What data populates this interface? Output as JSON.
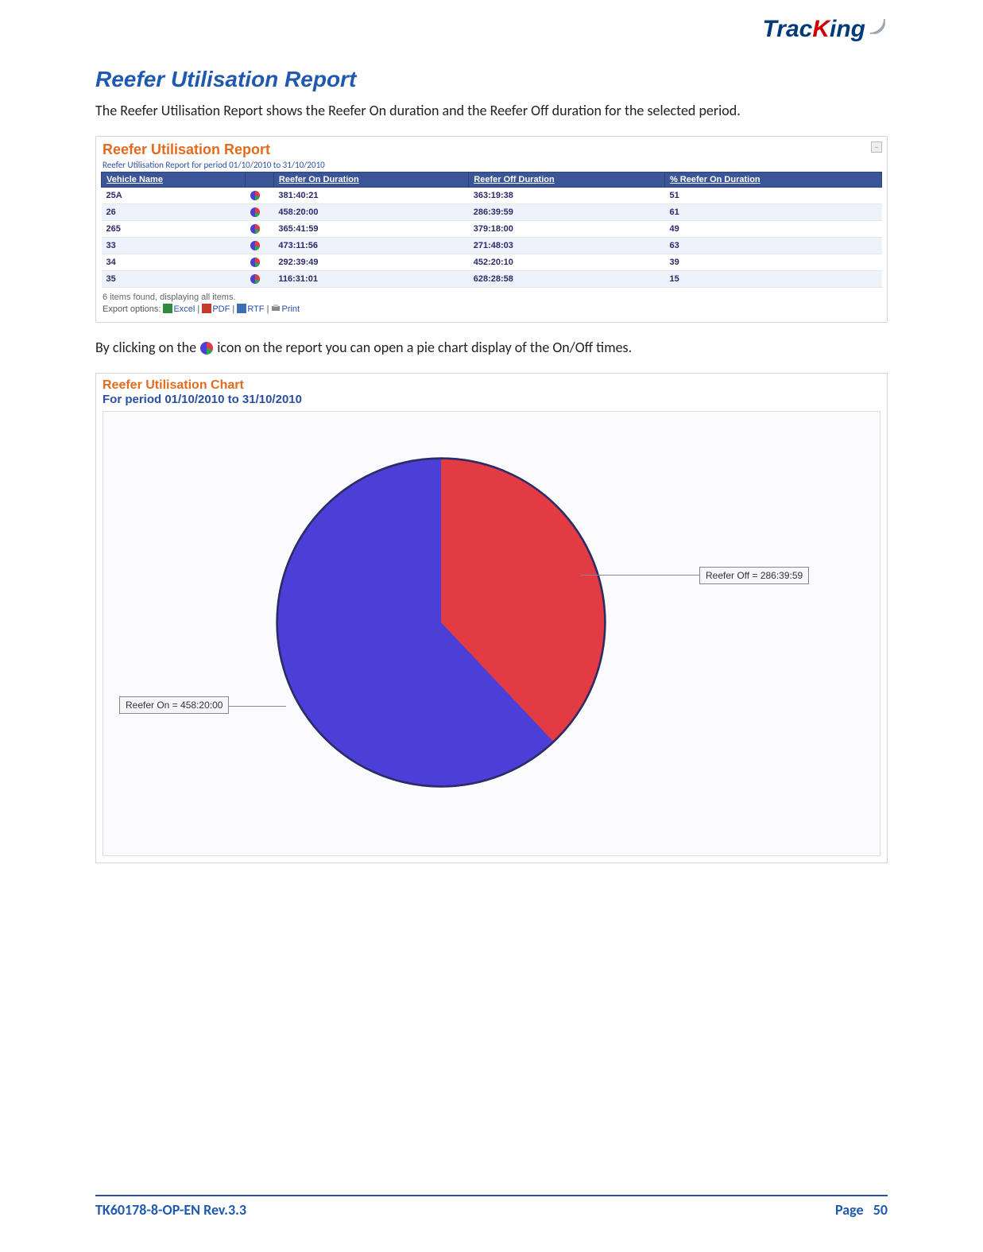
{
  "logo": {
    "part1": "Trac",
    "k": "K",
    "part2": "ing"
  },
  "section_title": "Reefer Utilisation Report",
  "intro_text": "The Reefer Utilisation Report shows the Reefer On duration and the Reefer Off duration for the selected period.",
  "report": {
    "title": "Reefer Utilisation Report",
    "subtitle": "Reefer Utilisation Report for period 01/10/2010 to 31/10/2010",
    "columns": [
      "Vehicle Name",
      "",
      "Reefer On Duration",
      "Reefer Off Duration",
      "% Reefer On Duration"
    ],
    "rows": [
      {
        "name": "25A",
        "on": "381:40:21",
        "off": "363:19:38",
        "pct": "51"
      },
      {
        "name": "26",
        "on": "458:20:00",
        "off": "286:39:59",
        "pct": "61"
      },
      {
        "name": "265",
        "on": "365:41:59",
        "off": "379:18:00",
        "pct": "49"
      },
      {
        "name": "33",
        "on": "473:11:56",
        "off": "271:48:03",
        "pct": "63"
      },
      {
        "name": "34",
        "on": "292:39:49",
        "off": "452:20:10",
        "pct": "39"
      },
      {
        "name": "35",
        "on": "116:31:01",
        "off": "628:28:58",
        "pct": "15"
      }
    ],
    "items_found": "6 items found, displaying all items.",
    "export_label": "Export options:",
    "export_excel": "Excel",
    "export_pdf": "PDF",
    "export_rtf": "RTF",
    "export_print": "Print"
  },
  "mid_text_a": "By clicking on the ",
  "mid_text_b": " icon on the report you can open a pie chart display of the On/Off times.",
  "chart": {
    "title": "Reefer Utilisation Chart",
    "subtitle": "For period 01/10/2010 to 31/10/2010",
    "label_on": "Reefer On = 458:20:00",
    "label_off": "Reefer Off = 286:39:59"
  },
  "chart_data": {
    "type": "pie",
    "title": "Reefer Utilisation Chart",
    "subtitle": "For period 01/10/2010 to 31/10/2010",
    "series": [
      {
        "name": "Reefer On",
        "value": 458.33,
        "label": "Reefer On = 458:20:00",
        "color": "#4b3fd8"
      },
      {
        "name": "Reefer Off",
        "value": 286.67,
        "label": "Reefer Off = 286:39:59",
        "color": "#e23b44"
      }
    ]
  },
  "footer": {
    "doc_id": "TK60178-8-OP-EN Rev.3.3",
    "page_label": "Page",
    "page_num": "50"
  }
}
